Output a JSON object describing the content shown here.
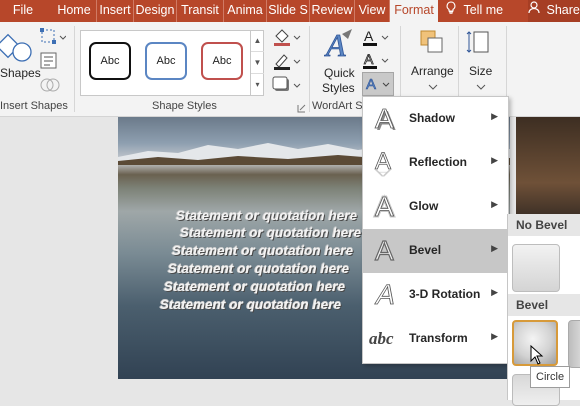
{
  "tabs": [
    {
      "label": "File",
      "active": false
    },
    {
      "label": "Home",
      "active": false
    },
    {
      "label": "Insert",
      "active": false
    },
    {
      "label": "Design",
      "active": false
    },
    {
      "label": "Transit",
      "active": false
    },
    {
      "label": "Anima",
      "active": false
    },
    {
      "label": "Slide S",
      "active": false
    },
    {
      "label": "Review",
      "active": false
    },
    {
      "label": "View",
      "active": false
    },
    {
      "label": "Format",
      "active": true
    }
  ],
  "tell_me": "Tell me",
  "share": "Share",
  "ribbon": {
    "shapes_label": "Shapes",
    "insert_shapes_group": "Insert Shapes",
    "shape_styles_group": "Shape Styles",
    "shape_style_samples": [
      "Abc",
      "Abc",
      "Abc"
    ],
    "quick_styles_line1": "Quick",
    "quick_styles_line2": "Styles",
    "wordart_group": "WordArt S",
    "arrange_label": "Arrange",
    "size_label": "Size"
  },
  "slide": {
    "quote_lines": [
      "Statement or quotation here",
      "Statement or quotation here",
      "Statement or quotation here",
      "Statement or quotation here",
      "Statement or quotation here",
      "Statement or quotation here"
    ]
  },
  "effects_menu": {
    "items": [
      {
        "label": "Shadow",
        "active": false
      },
      {
        "label": "Reflection",
        "active": false
      },
      {
        "label": "Glow",
        "active": false
      },
      {
        "label": "Bevel",
        "active": true
      },
      {
        "label": "3-D Rotation",
        "active": false
      },
      {
        "label": "Transform",
        "active": false
      }
    ],
    "transform_icon_text": "abc"
  },
  "bevel_submenu": {
    "no_bevel_header": "No Bevel",
    "bevel_header": "Bevel"
  },
  "tooltip": "Circle",
  "colors": {
    "tab_bar": "#b7472a",
    "ribbon": "#f3f3f3",
    "menu_active": "#c7c7c7"
  }
}
